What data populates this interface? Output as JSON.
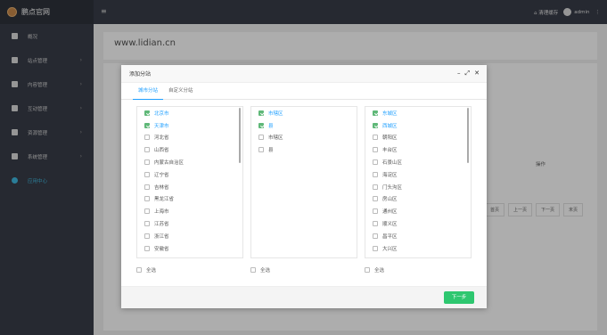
{
  "header": {
    "brand": "鹏点官网",
    "menu_toggle": "≡",
    "clear_cache": "清理缓存",
    "user": "admin",
    "more": "⋮"
  },
  "sidebar": {
    "items": [
      {
        "label": "概况",
        "icon": "dashboard-icon",
        "arrow": ""
      },
      {
        "label": "站点管理",
        "icon": "grid-icon",
        "arrow": "›"
      },
      {
        "label": "内容管理",
        "icon": "document-icon",
        "arrow": "›"
      },
      {
        "label": "互动管理",
        "icon": "eye-icon",
        "arrow": "›"
      },
      {
        "label": "资源管理",
        "icon": "file-icon",
        "arrow": "›"
      },
      {
        "label": "系统管理",
        "icon": "gear-icon",
        "arrow": "›"
      },
      {
        "label": "应用中心",
        "icon": "globe-icon",
        "arrow": ""
      }
    ]
  },
  "main": {
    "site_url": "www.lidian.cn",
    "operation_col": "操作",
    "pager": [
      "首页",
      "上一页",
      "下一页",
      "末页"
    ]
  },
  "modal": {
    "title": "添加分站",
    "ctrl_min": "–",
    "ctrl_max": "⤢",
    "ctrl_close": "✕",
    "tabs": [
      "城市分站",
      "自定义分站"
    ],
    "columns": [
      [
        {
          "t": "北京市",
          "on": true
        },
        {
          "t": "天津市",
          "on": true
        },
        {
          "t": "河北省"
        },
        {
          "t": "山西省"
        },
        {
          "t": "内蒙古自治区"
        },
        {
          "t": "辽宁省"
        },
        {
          "t": "吉林省"
        },
        {
          "t": "黑龙江省"
        },
        {
          "t": "上海市"
        },
        {
          "t": "江苏省"
        },
        {
          "t": "浙江省"
        },
        {
          "t": "安徽省"
        }
      ],
      [
        {
          "t": "市辖区",
          "on": true
        },
        {
          "t": "县",
          "on": true
        },
        {
          "t": "市辖区"
        },
        {
          "t": "县"
        }
      ],
      [
        {
          "t": "东城区",
          "on": true
        },
        {
          "t": "西城区",
          "on": true
        },
        {
          "t": "朝阳区"
        },
        {
          "t": "丰台区"
        },
        {
          "t": "石景山区"
        },
        {
          "t": "海淀区"
        },
        {
          "t": "门头沟区"
        },
        {
          "t": "房山区"
        },
        {
          "t": "通州区"
        },
        {
          "t": "顺义区"
        },
        {
          "t": "昌平区"
        },
        {
          "t": "大兴区"
        }
      ]
    ],
    "select_all": "全选",
    "next": "下一步"
  }
}
